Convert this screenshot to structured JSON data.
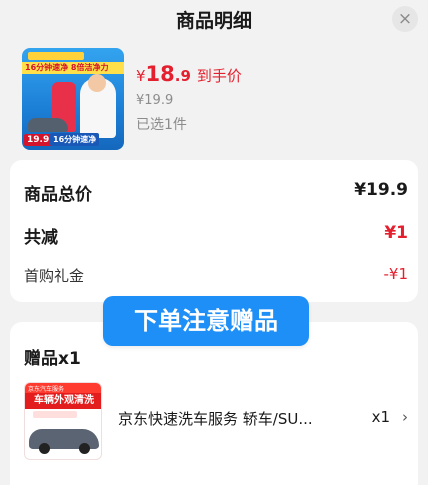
{
  "header": {
    "title": "商品明细",
    "close_symbol": "×"
  },
  "product": {
    "image_icon": "product-thumbnail-image",
    "image_banner_text": "16分钟速净 8倍洁净力",
    "image_price_badge": "19.9",
    "image_slogan": "16分钟速净",
    "price_symbol": "¥",
    "price_int": "18",
    "price_dec": ".9",
    "price_tag": "到手价",
    "original_price": "¥19.9",
    "selected_count": "已选1件"
  },
  "summary": {
    "total_label": "商品总价",
    "total_value": "¥19.9",
    "reduce_label": "共减",
    "reduce_value": "¥1",
    "coupon_label": "首购礼金",
    "coupon_value": "-¥1"
  },
  "overlay": {
    "text": "下单注意赠品"
  },
  "gift": {
    "title": "赠品x1",
    "image_icon": "gift-thumbnail-image",
    "image_brand": "京东汽车服务",
    "image_title": "车辆外观清洗",
    "name": "京东快速洗车服务 轿车/SU...",
    "qty": "x1",
    "chevron_symbol": "›"
  },
  "colors": {
    "price_red": "#e4202f",
    "overlay_blue": "#1e8ff6",
    "background": "#f2f2f2"
  }
}
